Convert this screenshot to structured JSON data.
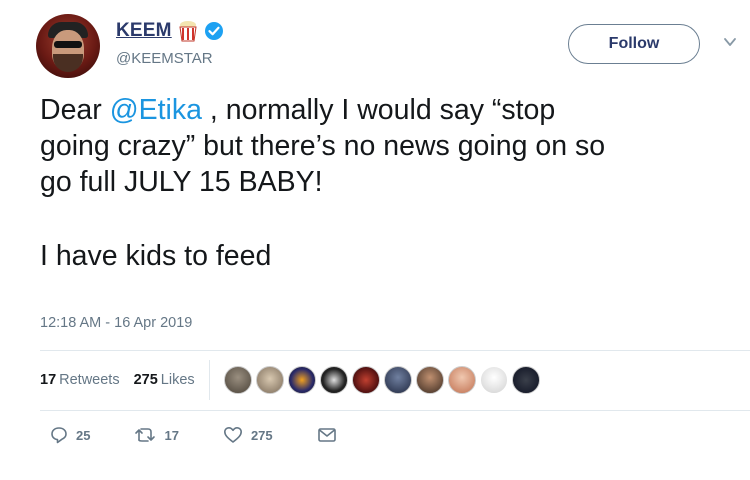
{
  "user": {
    "display_name": "KEEM",
    "handle": "@KEEMSTAR"
  },
  "follow_button": {
    "label": "Follow"
  },
  "tweet": {
    "line1_before": "Dear ",
    "mention": "@Etika",
    "line1_after": " , normally I would say “stop",
    "line2": "going crazy” but there’s no news going on so",
    "line3": "go full JULY 15 BABY!",
    "line4": "I have kids to feed"
  },
  "timestamp": "12:18 AM - 16 Apr 2019",
  "stats": {
    "retweets_count": "17",
    "retweets_label": "Retweets",
    "likes_count": "275",
    "likes_label": "Likes"
  },
  "actions": {
    "reply_count": "25",
    "retweet_count": "17",
    "like_count": "275"
  },
  "colors": {
    "link": "#1b95e0",
    "name": "#2b3a6b",
    "muted": "#657786",
    "verified": "#1da1f2"
  },
  "icons": [
    "popcorn-icon",
    "verified-icon",
    "chevron-down-icon",
    "reply-icon",
    "retweet-icon",
    "like-icon",
    "direct-message-icon"
  ]
}
